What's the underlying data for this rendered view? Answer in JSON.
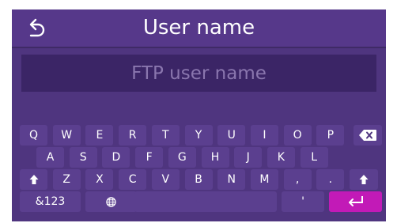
{
  "header": {
    "title": "User name",
    "back_icon": "back-arrow-icon"
  },
  "input": {
    "value": "",
    "placeholder": "FTP user name"
  },
  "keyboard": {
    "row1": [
      "Q",
      "W",
      "E",
      "R",
      "T",
      "Y",
      "U",
      "I",
      "O",
      "P"
    ],
    "row2": [
      "A",
      "S",
      "D",
      "F",
      "G",
      "H",
      "J",
      "K",
      "L"
    ],
    "row3": [
      "Z",
      "X",
      "C",
      "V",
      "B",
      "N",
      "M",
      ",",
      "."
    ],
    "row4": {
      "numbers": "&123",
      "globe_icon": "globe-icon",
      "apostrophe": "'",
      "enter_icon": "enter-icon"
    },
    "backspace_icon": "backspace-icon",
    "shift_icon": "shift-icon"
  },
  "colors": {
    "background": "#4f357f",
    "header": "#56388a",
    "input": "#3b2566",
    "key": "#5b3f8f",
    "enter": "#c21ab7"
  }
}
